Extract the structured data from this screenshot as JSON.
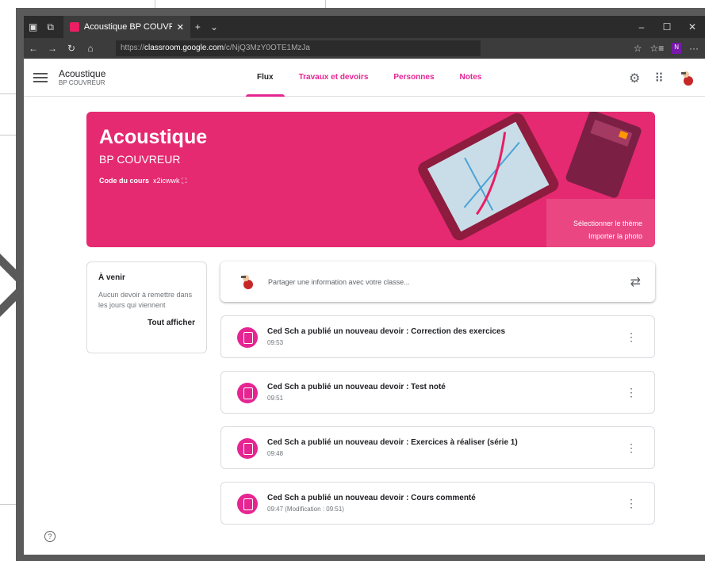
{
  "browser": {
    "tab_title": "Acoustique BP COUVRE",
    "url_prefix": "https://",
    "url_domain": "classroom.google.com",
    "url_path": "/c/NjQ3MzY0OTE1MzJa",
    "new_tab": "+",
    "tab_menu": "⌄",
    "win_min": "–",
    "win_max": "☐",
    "win_close": "✕",
    "back": "←",
    "forward": "→",
    "refresh": "↻",
    "home": "⌂",
    "favorites_star": "☆",
    "favorites_list": "☆≡",
    "onenote": "N",
    "more": "···"
  },
  "header": {
    "course_title": "Acoustique",
    "course_sub": "BP COUVREUR",
    "tabs": [
      {
        "label": "Flux"
      },
      {
        "label": "Travaux et devoirs"
      },
      {
        "label": "Personnes"
      },
      {
        "label": "Notes"
      }
    ]
  },
  "banner": {
    "title": "Acoustique",
    "section": "BP COUVREUR",
    "code_label": "Code du cours",
    "code_value": "x2icwwk",
    "select_theme": "Sélectionner le thème",
    "import_photo": "Importer la photo"
  },
  "upcoming": {
    "title": "À venir",
    "description": "Aucun devoir à remettre dans les jours qui viennent",
    "view_all": "Tout afficher"
  },
  "share": {
    "placeholder": "Partager une information avec votre classe..."
  },
  "posts": [
    {
      "title": "Ced Sch a publié un nouveau devoir : Correction des exercices",
      "time": "09:53"
    },
    {
      "title": "Ced Sch a publié un nouveau devoir : Test noté",
      "time": "09:51"
    },
    {
      "title": "Ced Sch a publié un nouveau devoir : Exercices à réaliser (série 1)",
      "time": "09:48"
    },
    {
      "title": "Ced Sch a publié un nouveau devoir : Cours commenté",
      "time": "09:47 (Modification : 09:51)"
    }
  ],
  "colors": {
    "accent": "#e52592",
    "banner": "#e52a71"
  },
  "help": "?"
}
